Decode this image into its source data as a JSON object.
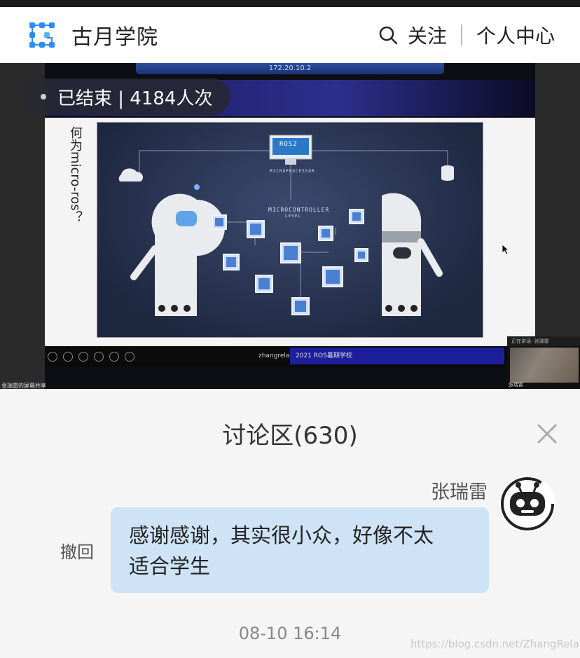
{
  "header": {
    "brand_title": "古月学院",
    "follow_label": "关注",
    "profile_label": "个人中心"
  },
  "video": {
    "remote_ip": "172.20.10.2",
    "status_text": "已结束 | 4184人次",
    "slide_vertical_text": "何为micro-ros？",
    "diagram_ros_label": "ROS2",
    "diagram_microprocessor_label": "MICROPROCESSOR",
    "diagram_microcontroller_label": "MICROCONTROLLER",
    "diagram_level_label": "LEVEL",
    "presenter_name": "zhangrelay",
    "slide_banner": "2021 ROS暑期学校",
    "share_label": "张瑞雷的屏幕共享",
    "cam_title": "正在讲话: 张瑞雷",
    "cam_name": "张瑞雷"
  },
  "discussion": {
    "title": "讨论区(630)",
    "sender": "张瑞雷",
    "message_line1": "感谢感谢，其实很小众，好像不太",
    "message_line2": "适合学生",
    "recall_label": "撤回",
    "timestamp": "08-10 16:14"
  },
  "watermark": "https://blog.csdn.net/ZhangRelay",
  "icons": {
    "logo": "grid-logo-icon",
    "search": "search-icon",
    "close": "close-icon",
    "avatar": "robot-avatar-icon"
  },
  "colors": {
    "bubble": "#cfe3f6",
    "logo_blue": "#2d8cf0",
    "slide_banner": "#1d1f9a"
  }
}
